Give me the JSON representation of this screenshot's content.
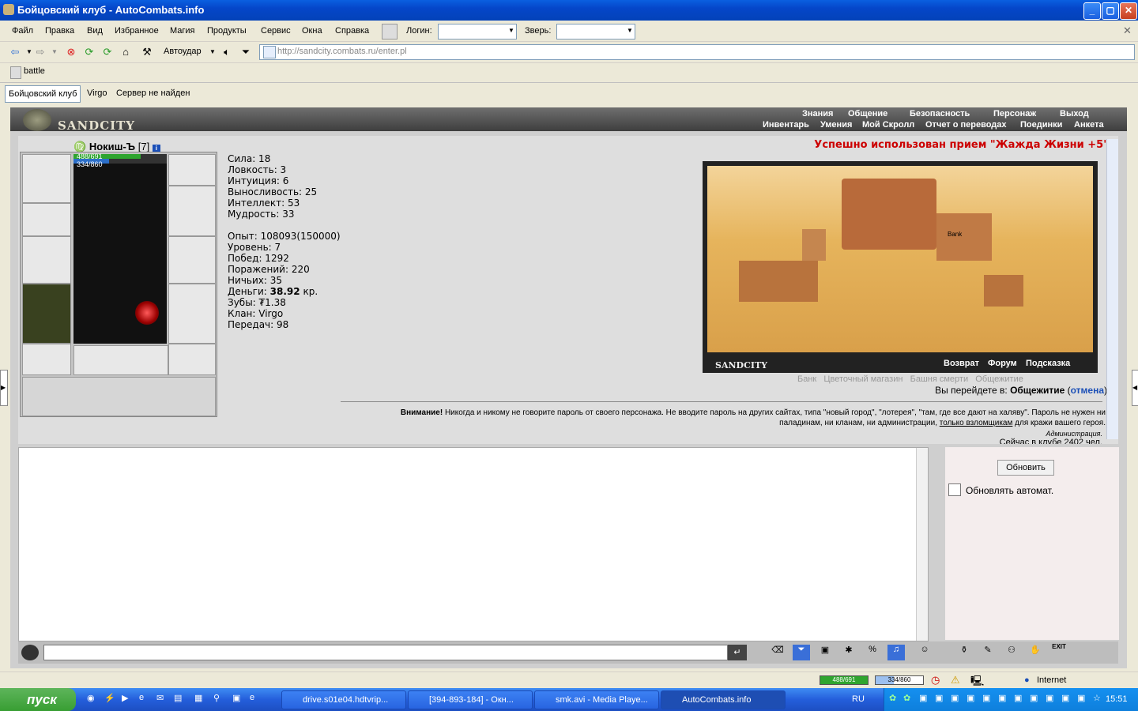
{
  "window": {
    "title": "Бойцовский клуб - AutoCombats.info",
    "minimize": "_",
    "maximize": "▢",
    "close": "✕"
  },
  "menubar": {
    "items": [
      "Файл",
      "Правка",
      "Вид",
      "Избранное",
      "Магия",
      "Продукты",
      "Сервис",
      "Окна",
      "Справка"
    ],
    "login_label": "Логин:",
    "pet_label": "Зверь:",
    "close_x": "✕"
  },
  "toolbar": {
    "autostrike": "Автоудар",
    "url": "http://sandcity.combats.ru/enter.pl"
  },
  "links": {
    "battle": "battle"
  },
  "tabs": [
    "Бойцовский клуб",
    "Virgo",
    "Сервер не найден"
  ],
  "game": {
    "logo": "SANDCITY",
    "nav_top": [
      "Знания",
      "Общение",
      "Безопасность",
      "Персонаж",
      "Выход"
    ],
    "nav_bottom": [
      "Инвентарь",
      "Умения",
      "Мой Скролл",
      "Отчет о переводах",
      "Поединки",
      "Анкета"
    ],
    "character": {
      "name": "Нокиш-Ъ",
      "level": "[7]",
      "hp": "488/691",
      "mana": "334/860"
    },
    "stats": [
      "Сила: 18",
      "Ловкость: 3",
      "Интуиция: 6",
      "Выносливость: 25",
      "Интеллект: 53",
      "Мудрость: 33"
    ],
    "info": [
      "Опыт: 108093(150000)",
      "Уровень: 7",
      "Побед: 1292",
      "Поражений: 220",
      "Ничьих: 35"
    ],
    "money_label": "Деньги:",
    "money_value": "38.92",
    "money_unit": "кр.",
    "teeth": "Зубы: ₮1.38",
    "clan": "Клан: Virgo",
    "transfers": "Передач: 98",
    "success_msg": "Успешно использован прием \"Жажда Жизни +5\"",
    "map": {
      "label": "SANDCITY",
      "links": [
        "Возврат",
        "Форум",
        "Подсказка"
      ],
      "bank_label": "Bank",
      "places": [
        "Банк",
        "Цветочный магазин",
        "Башня смерти",
        "Общежитие"
      ]
    },
    "goto_prefix": "Вы перейдете в:",
    "goto_place": "Общежитие",
    "goto_cancel": "отмена",
    "warning_title": "Внимание!",
    "warning_text": "Никогда и никому не говорите пароль от своего персонажа. Не вводите пароль на других сайтах, типа \"новый город\", \"лотерея\", \"там, где все дают на халяву\". Пароль не нужен ни паладинам, ни кланам, ни администрации,",
    "warning_link": "только взломщикам",
    "warning_tail": "для кражи вашего героя.",
    "admin": "Администрация.",
    "online": "Сейчас в клубе 2402 чел.",
    "refresh_btn": "Обновить",
    "auto_refresh": "Обновлять автомат."
  },
  "statusbar": {
    "hp": "488/691",
    "mana": "334/860",
    "zone": "Internet"
  },
  "taskbar": {
    "start": "пуск",
    "tasks": [
      "drive.s01e04.hdtvrip...",
      "[394-893-184] - Окн...",
      "smk.avi - Media Playe...",
      "AutoCombats.info"
    ],
    "lang": "RU",
    "clock": "15:51"
  },
  "colors": {
    "hp_bar": "#2fa52f",
    "mana_bar": "#2c6fc8",
    "success": "#cc0000",
    "title_blue": "#0546c9"
  }
}
